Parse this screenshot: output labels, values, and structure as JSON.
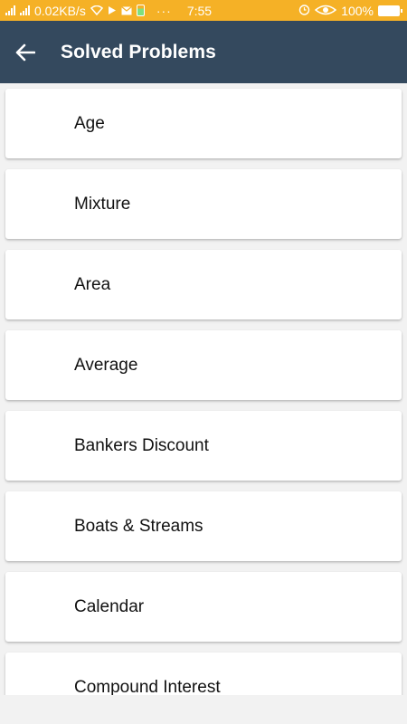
{
  "status_bar": {
    "speed": "0.02KB/s",
    "time": "7:55",
    "battery": "100%",
    "icons": [
      "signal-icon",
      "signal-icon",
      "wifi-icon",
      "play-store-icon",
      "mail-icon",
      "battery-small-icon",
      "more-dots-icon",
      "alarm-icon",
      "eye-icon",
      "battery-icon"
    ]
  },
  "app_bar": {
    "title": "Solved Problems",
    "back_icon": "arrow-back-icon",
    "color": "#34495e"
  },
  "status_color": "#f5b126",
  "items": [
    {
      "label": "Age"
    },
    {
      "label": "Mixture"
    },
    {
      "label": "Area"
    },
    {
      "label": "Average"
    },
    {
      "label": "Bankers Discount"
    },
    {
      "label": "Boats & Streams"
    },
    {
      "label": "Calendar"
    },
    {
      "label": "Compound Interest"
    }
  ]
}
